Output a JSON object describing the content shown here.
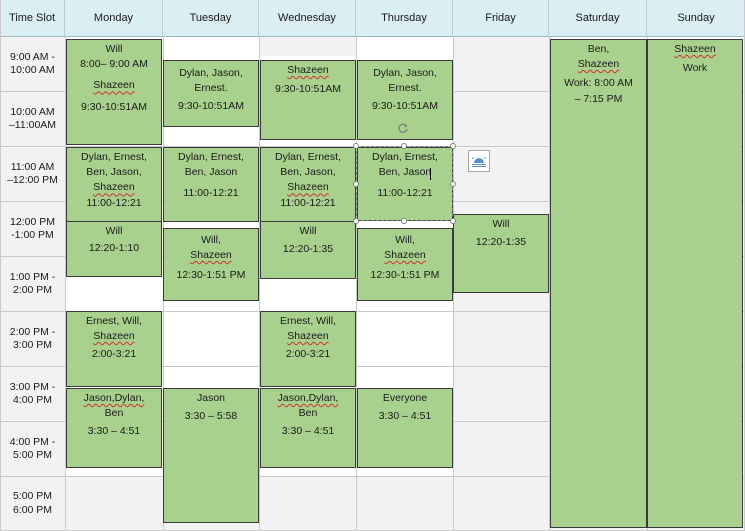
{
  "header": {
    "time_slot": "Time Slot",
    "days": [
      "Monday",
      "Tuesday",
      "Wednesday",
      "Thursday",
      "Friday",
      "Saturday",
      "Sunday"
    ]
  },
  "time_slots": [
    "9:00 AM -\n10:00 AM",
    "10:00 AM\n–11:00AM",
    "11:00 AM\n–12:00 PM",
    "12:00 PM\n-1:00 PM",
    "1:00 PM -\n2:00 PM",
    "2:00 PM -\n3:00 PM",
    "3:00 PM -\n4:00 PM",
    "4:00 PM -\n5:00 PM",
    "5:00 PM\n6:00 PM"
  ],
  "events": {
    "mon_1": {
      "l1": "Will",
      "l2": "8:00– 9:00 AM",
      "l3": "Shazeen",
      "l4": "9:30-10:51AM"
    },
    "tue_1": {
      "l1": "Dylan, Jason,",
      "l2": "Ernest.",
      "l3": "9:30-10:51AM"
    },
    "wed_1": {
      "l1": "Shazeen",
      "l2": "9:30-10:51AM"
    },
    "thu_1": {
      "l1": "Dylan, Jason,",
      "l2": "Ernest.",
      "l3": "9:30-10:51AM"
    },
    "sat_1": {
      "l1a": "Ben, ",
      "l1b": "Shazeen",
      "l2": "Work: 8:00 AM",
      "l3": "– 7:15 PM"
    },
    "sun_1": {
      "l1": "Shazeen",
      "l2": "Work"
    },
    "mon_2": {
      "l1": "Dylan, Ernest,",
      "l2": "Ben, Jason,",
      "l3": "Shazeen",
      "l4": "11:00-12:21"
    },
    "tue_2": {
      "l1": "Dylan, Ernest,",
      "l2": "Ben, Jason",
      "l3": "11:00-12:21"
    },
    "wed_2": {
      "l1": "Dylan, Ernest,",
      "l2": "Ben, Jason,",
      "l3": "Shazeen",
      "l4": "11:00-12:21"
    },
    "thu_2": {
      "l1": "Dylan, Ernest,",
      "l2": "Ben, Jason",
      "l3": "11:00-12:21"
    },
    "mon_3": {
      "l1": "Will",
      "l2": "12:20-1:10"
    },
    "tue_3": {
      "l1a": "Will, ",
      "l1b": "Shazeen",
      "l2": "12:30-1:51 PM"
    },
    "wed_3": {
      "l1": "Will",
      "l2": "12:20-1:35"
    },
    "thu_3": {
      "l1a": "Will, ",
      "l1b": "Shazeen",
      "l2": "12:30-1:51 PM"
    },
    "fri_1": {
      "l1": "Will",
      "l2": "12:20-1:35"
    },
    "mon_4": {
      "l1": "Ernest, Will,",
      "l2": "Shazeen",
      "l3": "2:00-3:21"
    },
    "wed_4": {
      "l1": "Ernest, Will,",
      "l2": "Shazeen",
      "l3": "2:00-3:21"
    },
    "mon_5": {
      "l1": "Jason,Dylan,",
      "l2": "Ben",
      "l3": "3:30 – 4:51"
    },
    "tue_4": {
      "l1": "Jason",
      "l2": "3:30 – 5:58"
    },
    "wed_5": {
      "l1": "Jason,Dylan,",
      "l2": "Ben",
      "l3": "3:30 – 4:51"
    },
    "thu_4": {
      "l1": "Everyone",
      "l2": "3:30 – 4:51"
    }
  }
}
